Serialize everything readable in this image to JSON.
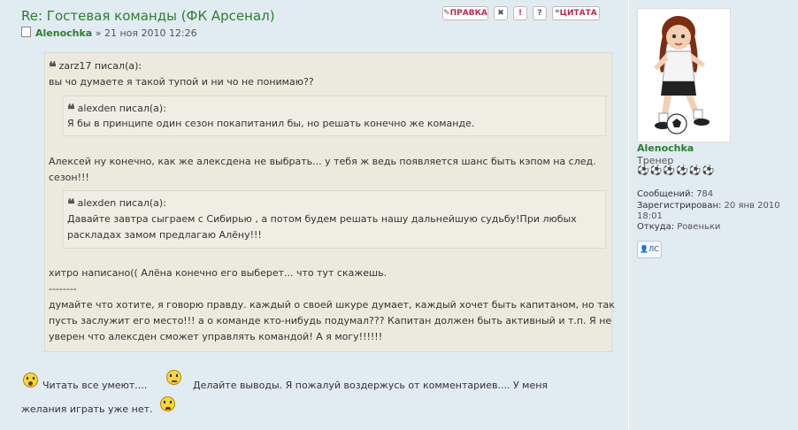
{
  "post": {
    "title": "Re: Гостевая команды (ФК Арсенал)",
    "author_prefix": "",
    "author": "Alenochka",
    "date": "» 21 ноя 2010 12:26",
    "buttons": {
      "edit": "ПРАВКА",
      "delete": "✖",
      "report": "!",
      "info": "?",
      "quote": "ЦИТАТА"
    }
  },
  "content": {
    "quote1": {
      "cite": "zarz17 писал(а):",
      "line1": "вы чо думаете я такой тупой и ни чо не понимаю??",
      "nested1": {
        "cite": "alexden писал(а):",
        "text": "Я бы в принципе один сезон покапитанил бы, но решать конечно же команде."
      },
      "para": "Алексей ну конечно, как же алексдена не выбрать... у тебя ж ведь появляется шанс быть кэпом на след.",
      "para2": "сезон!!!",
      "nested2": {
        "cite": "alexden писал(а):",
        "text1": "Давайте завтра сыграем с Сибирью , а потом будем решать нашу дальнейшую судьбу!При любых",
        "text2": "раскладах замом предлагаю Алёну!!!"
      },
      "after1": "хитро написано(( Алёна конечно его выберет... что тут скажешь.",
      "sep": "--------",
      "after2": "думайте что хотите, я говорю правду. каждый о своей шкуре думает, каждый хочет быть капитаном, но так",
      "after3": "пусть заслужит его место!!! а о команде кто-нибудь подумал??? Капитан должен быть активный и т.п. Я не",
      "after4": "уверен что алексден сможет управлять командой! А я могу!!!!!!"
    },
    "reply1a": "Читать все умеют....",
    "reply1b": "Делайте выводы. Я пожалуй воздержусь от комментариев.... У меня",
    "reply2": "желания играть уже нет."
  },
  "profile": {
    "name": "Alenochka",
    "rank": "Тренер",
    "stars": "⚽⚽⚽⚽⚽⚽",
    "posts_label": "Сообщений:",
    "posts_value": "784",
    "registered_label": "Зарегистрирован:",
    "registered_value": "20 янв 2010",
    "registered_time": "18:01",
    "from_label": "Откуда:",
    "from_value": "Ровеньки",
    "pm_label": "ЛС"
  },
  "colors": {
    "background": "#e1ebf2",
    "quote_bg": "#ebeadd",
    "username": "#2e7d32",
    "button_text": "#bc2a4d"
  }
}
